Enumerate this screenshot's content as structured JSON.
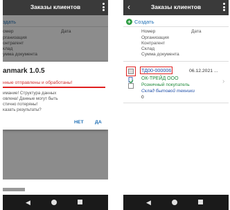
{
  "left_phone": {
    "appbar": {
      "title": "Заказы клиентов"
    },
    "create_label": "здать",
    "columns": {
      "number": "омер",
      "date": "Дата",
      "org": "рганизация",
      "contr": "онтрагент",
      "wh": "клад",
      "sum": "умма документа"
    },
    "dialog": {
      "title": "anmark 1.0.5",
      "subtitle": "нные отправлены и обработаны!",
      "line1": "имание! Структура данных",
      "line2": "овлена! Данные могут быть",
      "line3": "стично потеряны!",
      "line4": "казать результаты?",
      "no_label": "НЕТ",
      "yes_label": "ДА"
    }
  },
  "right_phone": {
    "appbar": {
      "title": "Заказы клиентов",
      "back_icon": "back-chevron-icon"
    },
    "create_label": "Создать",
    "columns": {
      "number": "Номер",
      "date": "Дата",
      "org": "Организация",
      "contr": "Контрагент",
      "wh": "Склад",
      "sum": "Сумма документа"
    },
    "row": {
      "number": "ТД00-000006",
      "date": "06.12.2021 ...",
      "org": "ОК-ТРЕЙД ООО",
      "contr": "Розничный покупатель",
      "wh": "Склад бытовой техники",
      "sum": "0"
    }
  },
  "colors": {
    "appbar": "#3a3a3a",
    "accent_green": "#2f9e44",
    "link_blue": "#1f4fa8",
    "highlight_red": "#e02020",
    "navbar": "#1a1a1a"
  }
}
